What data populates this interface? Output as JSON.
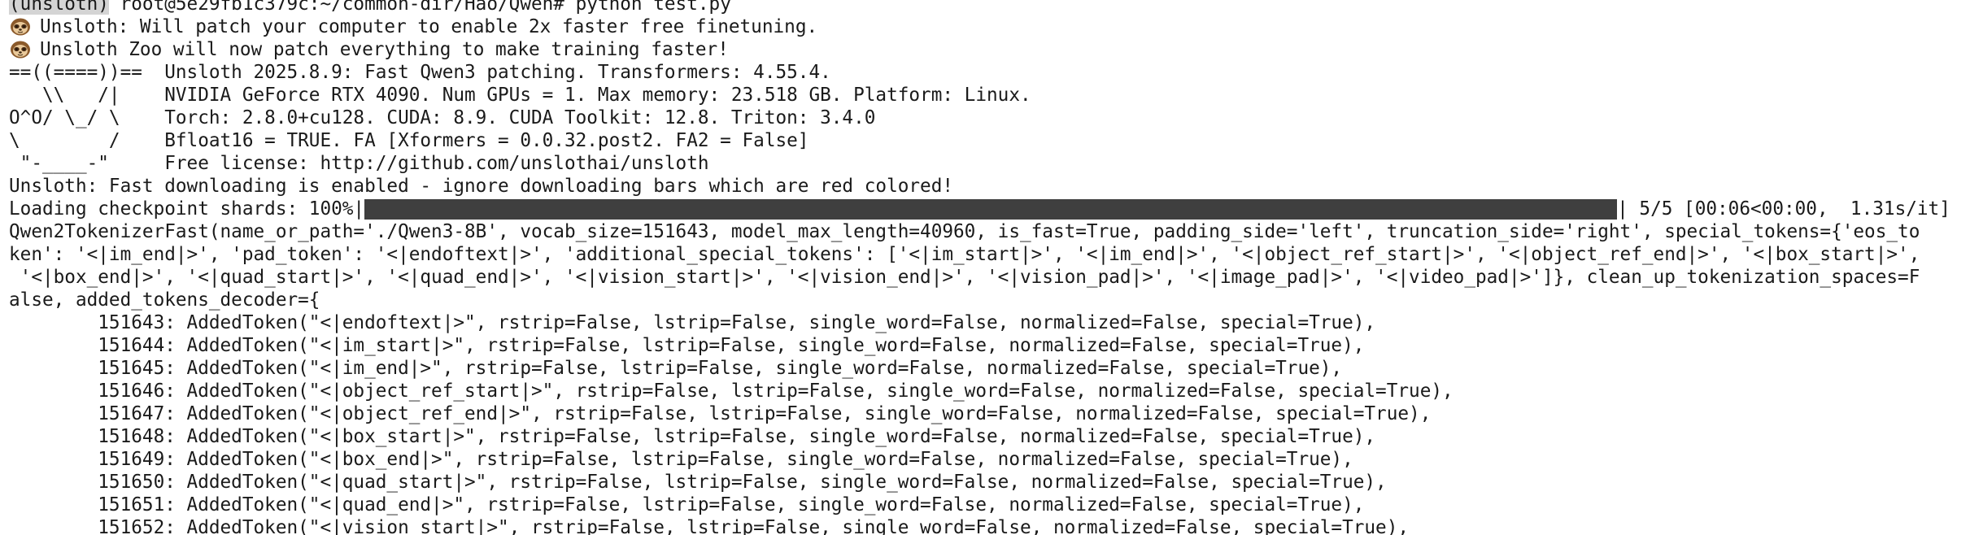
{
  "theme": {
    "background": "#ffffff",
    "foreground": "#1a1a1a",
    "progress_bar_fill": "#3f3f3f",
    "venv_highlight": "#d4d4d4"
  },
  "prompt": {
    "venv": "(unsloth)",
    "user_host_path": " root@5e29fb1c379c:~/common-dir/Hao/Qwen# ",
    "command": "python test.py"
  },
  "banner": [
    {
      "icon": "sloth-icon",
      "text": "Unsloth: Will patch your computer to enable 2x faster free finetuning."
    },
    {
      "icon": "sloth-icon",
      "text": "Unsloth Zoo will now patch everything to make training faster!"
    }
  ],
  "info_lines": [
    "==((====))==  Unsloth 2025.8.9: Fast Qwen3 patching. Transformers: 4.55.4.",
    "   \\\\   /|    NVIDIA GeForce RTX 4090. Num GPUs = 1. Max memory: 23.518 GB. Platform: Linux.",
    "O^O/ \\_/ \\    Torch: 2.8.0+cu128. CUDA: 8.9. CUDA Toolkit: 12.8. Triton: 3.4.0",
    "\\        /    Bfloat16 = TRUE. FA [Xformers = 0.0.32.post2. FA2 = False]",
    " \"-____-\"     Free license: http://github.com/unslothai/unsloth",
    "Unsloth: Fast downloading is enabled - ignore downloading bars which are red colored!"
  ],
  "progress": {
    "label": "Loading checkpoint shards: 100%|",
    "fraction": 1.0,
    "suffix": "| 5/5 [00:06<00:00,  1.31s/it]"
  },
  "tokenizer_lines": [
    "Qwen2TokenizerFast(name_or_path='./Qwen3-8B', vocab_size=151643, model_max_length=40960, is_fast=True, padding_side='left', truncation_side='right', special_tokens={'eos_to",
    "ken': '<|im_end|>', 'pad_token': '<|endoftext|>', 'additional_special_tokens': ['<|im_start|>', '<|im_end|>', '<|object_ref_start|>', '<|object_ref_end|>', '<|box_start|>',",
    " '<|box_end|>', '<|quad_start|>', '<|quad_end|>', '<|vision_start|>', '<|vision_end|>', '<|vision_pad|>', '<|image_pad|>', '<|video_pad|>']}, clean_up_tokenization_spaces=F",
    "alse, added_tokens_decoder={"
  ],
  "added_tokens": [
    "        151643: AddedToken(\"<|endoftext|>\", rstrip=False, lstrip=False, single_word=False, normalized=False, special=True),",
    "        151644: AddedToken(\"<|im_start|>\", rstrip=False, lstrip=False, single_word=False, normalized=False, special=True),",
    "        151645: AddedToken(\"<|im_end|>\", rstrip=False, lstrip=False, single_word=False, normalized=False, special=True),",
    "        151646: AddedToken(\"<|object_ref_start|>\", rstrip=False, lstrip=False, single_word=False, normalized=False, special=True),",
    "        151647: AddedToken(\"<|object_ref_end|>\", rstrip=False, lstrip=False, single_word=False, normalized=False, special=True),",
    "        151648: AddedToken(\"<|box_start|>\", rstrip=False, lstrip=False, single_word=False, normalized=False, special=True),",
    "        151649: AddedToken(\"<|box_end|>\", rstrip=False, lstrip=False, single_word=False, normalized=False, special=True),",
    "        151650: AddedToken(\"<|quad_start|>\", rstrip=False, lstrip=False, single_word=False, normalized=False, special=True),",
    "        151651: AddedToken(\"<|quad_end|>\", rstrip=False, lstrip=False, single_word=False, normalized=False, special=True),",
    "        151652: AddedToken(\"<|vision_start|>\", rstrip=False, lstrip=False, single_word=False, normalized=False, special=True),"
  ]
}
